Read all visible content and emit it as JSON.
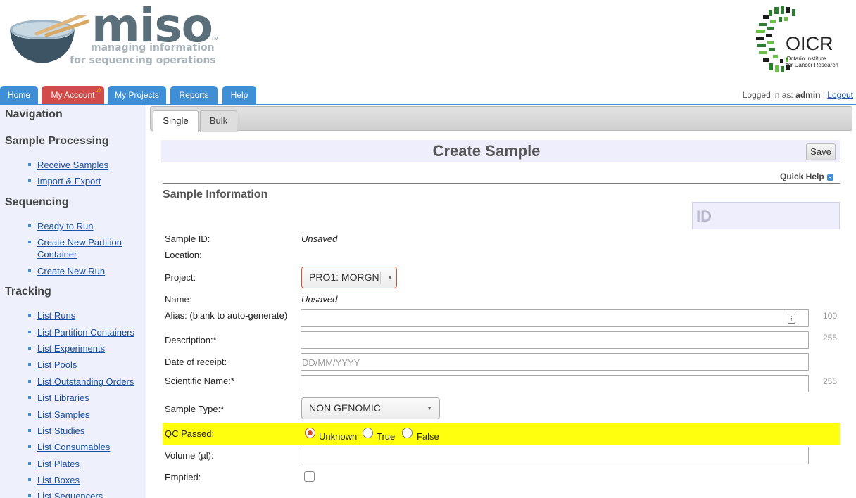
{
  "header": {
    "logo_text": "miso",
    "logo_tm": "TM",
    "tagline_1": "managing information",
    "tagline_2": "for sequencing operations",
    "org_name": "OICR",
    "org_full_1": "Ontario Institute",
    "org_full_2": "for Cancer Research"
  },
  "nav": {
    "tabs": [
      "Home",
      "My Account",
      "My Projects",
      "Reports",
      "Help"
    ],
    "account_badge_icon": "warning-icon"
  },
  "login": {
    "prefix": "Logged in as:",
    "user": "admin",
    "separator": "|",
    "logout": "Logout"
  },
  "sidebar": {
    "title": "Navigation",
    "sections": [
      {
        "heading": "Sample Processing",
        "items": [
          "Receive Samples",
          "Import & Export"
        ]
      },
      {
        "heading": "Sequencing",
        "items": [
          "Ready to Run",
          "Create New Partition Container",
          "Create New Run"
        ]
      },
      {
        "heading": "Tracking",
        "items": [
          "List Runs",
          "List Partition Containers",
          "List Experiments",
          "List Pools",
          "List Outstanding Orders",
          "List Libraries",
          "List Samples",
          "List Studies",
          "List Consumables",
          "List Plates",
          "List Boxes",
          "List Sequencers"
        ]
      }
    ]
  },
  "subtabs": [
    "Single",
    "Bulk"
  ],
  "page": {
    "title": "Create Sample",
    "save": "Save",
    "quick_help": "Quick Help",
    "section_title": "Sample Information",
    "id_placeholder": "ID"
  },
  "form": {
    "sample_id": {
      "label": "Sample ID:",
      "value": "Unsaved"
    },
    "location": {
      "label": "Location:"
    },
    "project": {
      "label": "Project:",
      "value": "PRO1: MORGN"
    },
    "name": {
      "label": "Name:",
      "value": "Unsaved"
    },
    "alias": {
      "label": "Alias: (blank to auto-generate)",
      "max": "100"
    },
    "description": {
      "label": "Description:*",
      "max": "255"
    },
    "date_of_receipt": {
      "label": "Date of receipt:",
      "placeholder": "DD/MM/YYYY"
    },
    "scientific_name": {
      "label": "Scientific Name:*",
      "max": "255"
    },
    "sample_type": {
      "label": "Sample Type:*",
      "value": "NON GENOMIC"
    },
    "qc_passed": {
      "label": "QC Passed:",
      "options": [
        "Unknown",
        "True",
        "False"
      ],
      "selected": "Unknown",
      "highlight": "#ffff0e"
    },
    "volume": {
      "label": "Volume (µl):"
    },
    "emptied": {
      "label": "Emptied:",
      "checked": false
    }
  }
}
